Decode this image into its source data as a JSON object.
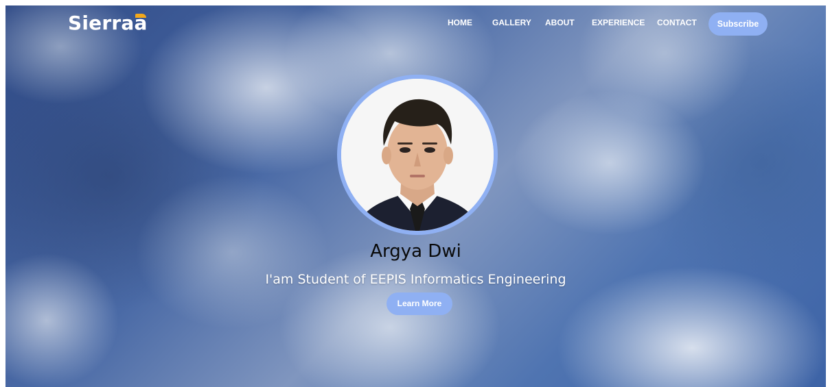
{
  "brand": {
    "logo_text": "Sierra",
    "logo_accent_letter": "a",
    "accent_color": "#f3a81b"
  },
  "nav": {
    "items": [
      {
        "label": "HOME"
      },
      {
        "label": "GALLERY"
      },
      {
        "label": "ABOUT"
      },
      {
        "label": "EXPERIENCE"
      },
      {
        "label": "CONTACT"
      }
    ],
    "subscribe_label": "Subscribe",
    "button_color": "#8fb0f3"
  },
  "hero": {
    "name": "Argya Dwi",
    "subtitle": "I'am Student of EEPIS Informatics Engineering",
    "cta_label": "Learn More",
    "background": "cloudy-sky",
    "profile_photo": "portrait-photo"
  }
}
